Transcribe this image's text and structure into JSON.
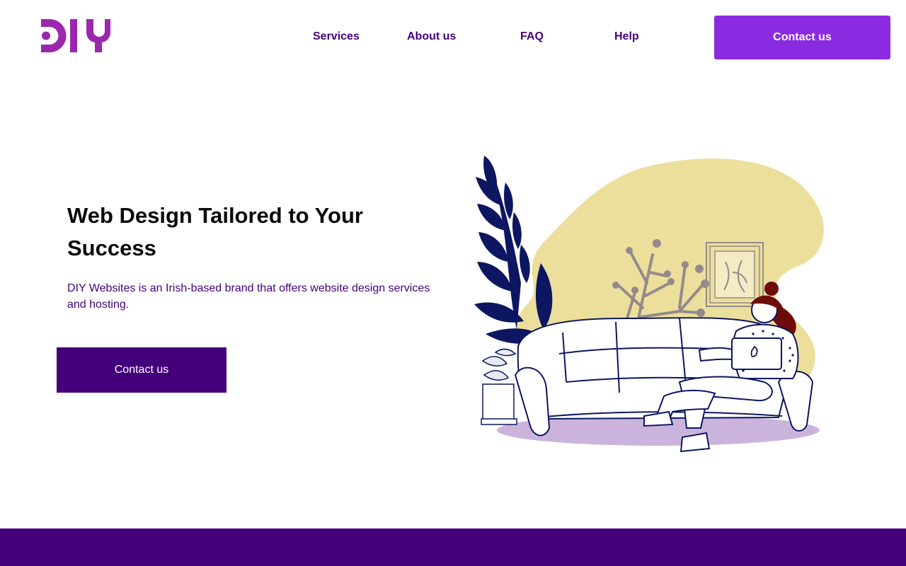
{
  "logo": {
    "text": "DIY",
    "color": "#9b27af"
  },
  "nav": {
    "items": [
      {
        "label": "Services"
      },
      {
        "label": "About us"
      },
      {
        "label": "FAQ"
      },
      {
        "label": "Help"
      }
    ],
    "cta_label": "Contact us"
  },
  "hero": {
    "title": "Web Design Tailored to Your Success",
    "description": "DIY Websites is an Irish-based brand that offers website design services and hosting.",
    "cta_label": "Contact us"
  },
  "illustration": {
    "description_icon": "woman-on-sofa-with-laptop-illustration"
  },
  "colors": {
    "primary_dark": "#43007a",
    "accent": "#8a2be2",
    "logo": "#9b27af",
    "blob_yellow": "#ecdf9c",
    "shadow_lilac": "#cbb4dc",
    "line_navy": "#0d1660"
  }
}
